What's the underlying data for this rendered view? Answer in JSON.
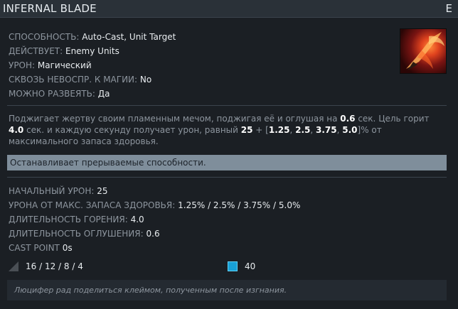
{
  "header": {
    "title": "INFERNAL BLADE",
    "hotkey": "E"
  },
  "ability_icon": "infernal-blade-icon",
  "attributes": [
    {
      "label": "СПОСОБНОСТЬ:",
      "value": "Auto-Cast, Unit Target"
    },
    {
      "label": "ДЕЙСТВУЕТ:",
      "value": "Enemy Units"
    },
    {
      "label": "УРОН:",
      "value": "Магический"
    },
    {
      "label": "СКВОЗЬ НЕВОСПР. К МАГИИ:",
      "value": "No"
    },
    {
      "label": "МОЖНО РАЗВЕЯТЬ:",
      "value": "Да"
    }
  ],
  "description": {
    "p1": "Поджигает жертву своим пламенным мечом, поджигая её и оглушая на ",
    "v1": "0.6",
    "p2": " сек. Цель горит ",
    "v2": "4.0",
    "p3": " сек. и каждую секунду получает урон, равный ",
    "v3": "25",
    "p4": " + [",
    "v4": "1.25",
    "s1": ", ",
    "v5": "2.5",
    "s2": ", ",
    "v6": "3.75",
    "s3": ", ",
    "v7": "5.0",
    "p5": "]% от максимального запаса здоровья."
  },
  "note": "Останавливает прерываемые способности.",
  "stats": [
    {
      "label": "НАЧАЛЬНЫЙ УРОН:",
      "value": "25"
    },
    {
      "label": "УРОНА ОТ МАКС. ЗАПАСА ЗДОРОВЬЯ:",
      "value": "1.25% / 2.5% / 3.75% / 5.0%"
    },
    {
      "label": "ДЛИТЕЛЬНОСТЬ ГОРЕНИЯ:",
      "value": "4.0"
    },
    {
      "label": "ДЛИТЕЛЬНОСТЬ ОГЛУШЕНИЯ:",
      "value": "0.6"
    },
    {
      "label": "CAST POINT",
      "value": "0s"
    }
  ],
  "costs": {
    "cooldown_icon": "cooldown-icon",
    "cooldown": "16 / 12 / 8 / 4",
    "mana_icon": "mana-icon",
    "mana": "40"
  },
  "lore": "Люцифер рад поделиться клеймом, полученным после изгнания.",
  "colors": {
    "note_bg": "#7f8e9b",
    "mana": "#18a0d6",
    "background": "#1b1f24"
  }
}
